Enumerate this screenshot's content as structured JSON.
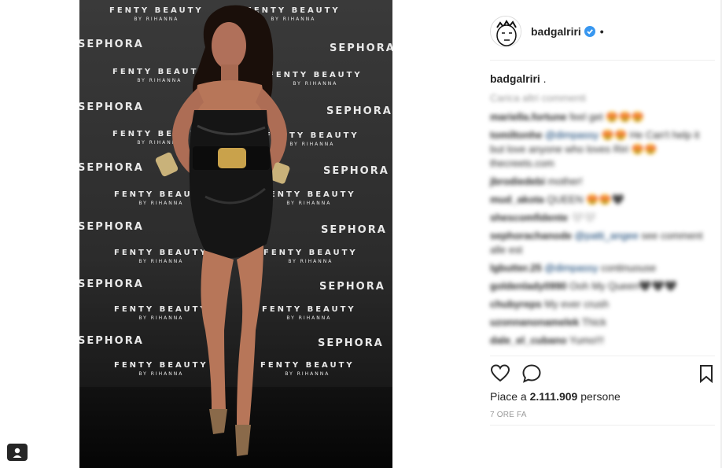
{
  "post": {
    "username": "badgalriri",
    "caption_user": "badgalriri",
    "caption_text": " .",
    "load_more": "Carica altri commenti",
    "comments": [
      {
        "user": "mariella.fortune",
        "text": " feel get 😍😍😍"
      },
      {
        "user": "tomiltonhe",
        "mention": "@dimpassy",
        "text": " 😍😍 He Can't help it but love anyone who loves Riri 😍😍 thecreets.com"
      },
      {
        "user": "jbrodiedebi",
        "text": " mother!"
      },
      {
        "user": "mud_akota",
        "text": " QUEEN 😍😍🖤"
      },
      {
        "user": "shescomfidente",
        "text": " 🤍🤍"
      },
      {
        "user": "sephorachanode",
        "mention": "@patti_angee",
        "text": " see comment alle est"
      },
      {
        "user": "lgbutter.25",
        "mention": "@dimpassy",
        "text": " continuouse"
      },
      {
        "user": "goldenlady0990",
        "text": " Ooh My Queen🖤🖤🖤"
      },
      {
        "user": "chubyreps",
        "text": " My ever crush"
      },
      {
        "user": "uzonnanonamelek",
        "text": " Thick"
      },
      {
        "user": "dale_el_cubano",
        "text": " Yumo!!!"
      }
    ],
    "likes_prefix": "Piace a ",
    "likes_count": "2.111.909",
    "likes_suffix": " persone",
    "time_ago": "7 ORE FA"
  },
  "photo": {
    "wall_brands": [
      "FENTY BEAUTY",
      "BY RIHANNA",
      "SEPHORA"
    ]
  },
  "icons": {
    "like": "heart-icon",
    "comment": "comment-bubble-icon",
    "save": "bookmark-icon",
    "verified": "verified-badge-icon",
    "corner": "person-badge-icon"
  },
  "colors": {
    "verified_blue": "#3897f0",
    "text": "#262626",
    "muted": "#999999",
    "mention": "#003569"
  }
}
